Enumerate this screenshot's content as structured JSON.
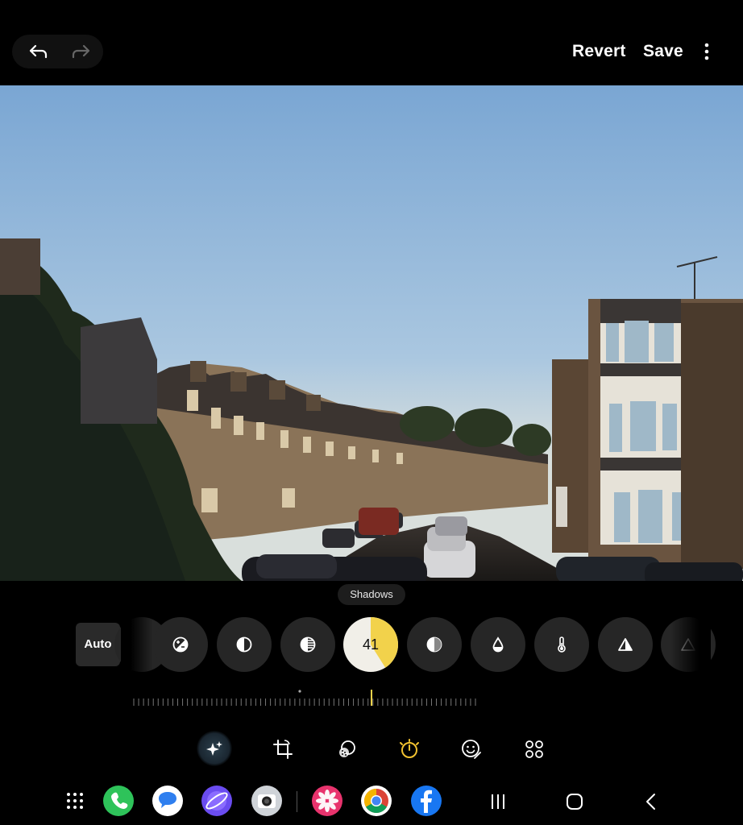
{
  "header": {
    "undo_icon": "undo-arrow-icon",
    "redo_icon": "redo-arrow-icon",
    "revert_label": "Revert",
    "save_label": "Save",
    "more_icon": "more-vertical-icon"
  },
  "photo": {
    "description_icon": "street-photo"
  },
  "adjust": {
    "tooltip": "Shadows",
    "auto_label": "Auto",
    "tools": [
      {
        "icon": "exposure-icon"
      },
      {
        "icon": "contrast-icon"
      },
      {
        "icon": "highlights-icon"
      },
      {
        "icon": "shadows-icon"
      },
      {
        "icon": "saturation-icon"
      },
      {
        "icon": "tint-drop-icon"
      },
      {
        "icon": "temperature-icon"
      },
      {
        "icon": "sharpness-icon"
      }
    ],
    "active_value": "41",
    "active_fraction": 0.41,
    "accent": "#f2d24b"
  },
  "edit_toolbar": {
    "items": [
      "ai-edit-icon",
      "crop-rotate-icon",
      "filters-icon",
      "adjust-tone-icon",
      "stickers-icon",
      "more-tools-icon"
    ],
    "active": "adjust-tone-icon"
  },
  "dock": {
    "apps": [
      "apps-grid-icon",
      "phone-app-icon",
      "messages-app-icon",
      "internet-app-icon",
      "camera-app-icon",
      "gallery-app-icon",
      "chrome-app-icon",
      "facebook-app-icon"
    ],
    "nav": [
      "recents-nav-icon",
      "home-nav-icon",
      "back-nav-icon"
    ]
  }
}
